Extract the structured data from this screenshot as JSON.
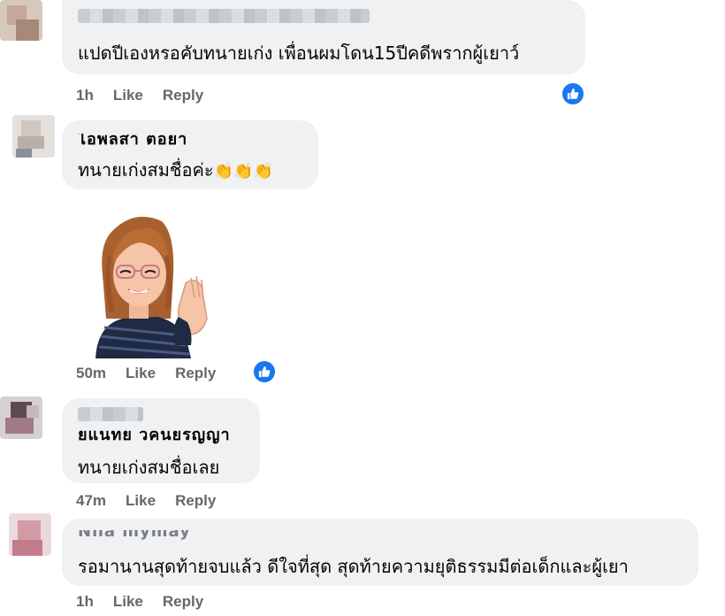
{
  "comments": [
    {
      "text": "แปดปีเองหรอคับทนายเก่ง เพื่อนผมโดน15ปีคดีพรากผู้เยาว์",
      "time": "1h",
      "like": "Like",
      "reply": "Reply"
    },
    {
      "name_partial": "ไอพลสา ตอยา",
      "text": "ทนายเก่งสมชื่อค่ะ",
      "emoji": [
        "👏",
        "👏",
        "👏"
      ],
      "time": "50m",
      "like": "Like",
      "reply": "Reply"
    },
    {
      "name_partial": "ยแนทย วคนยรญญา",
      "text": "ทนายเก่งสมชื่อเลย",
      "time": "47m",
      "like": "Like",
      "reply": "Reply"
    },
    {
      "name_partial": "Nna  mymay",
      "text": "รอมานานสุดท้ายจบแล้ว ดีใจที่สุด สุดท้ายความยุติธรรมมีต่อเด็กและผู้เยา",
      "time": "1h",
      "like": "Like",
      "reply": "Reply"
    }
  ],
  "colors": {
    "bubble": "#eff1f3",
    "meta": "#65676b",
    "like_badge": "#1877f2"
  },
  "icons": {
    "reaction": "thumbs-up-icon",
    "sticker": "avatar-clapping-sticker"
  }
}
